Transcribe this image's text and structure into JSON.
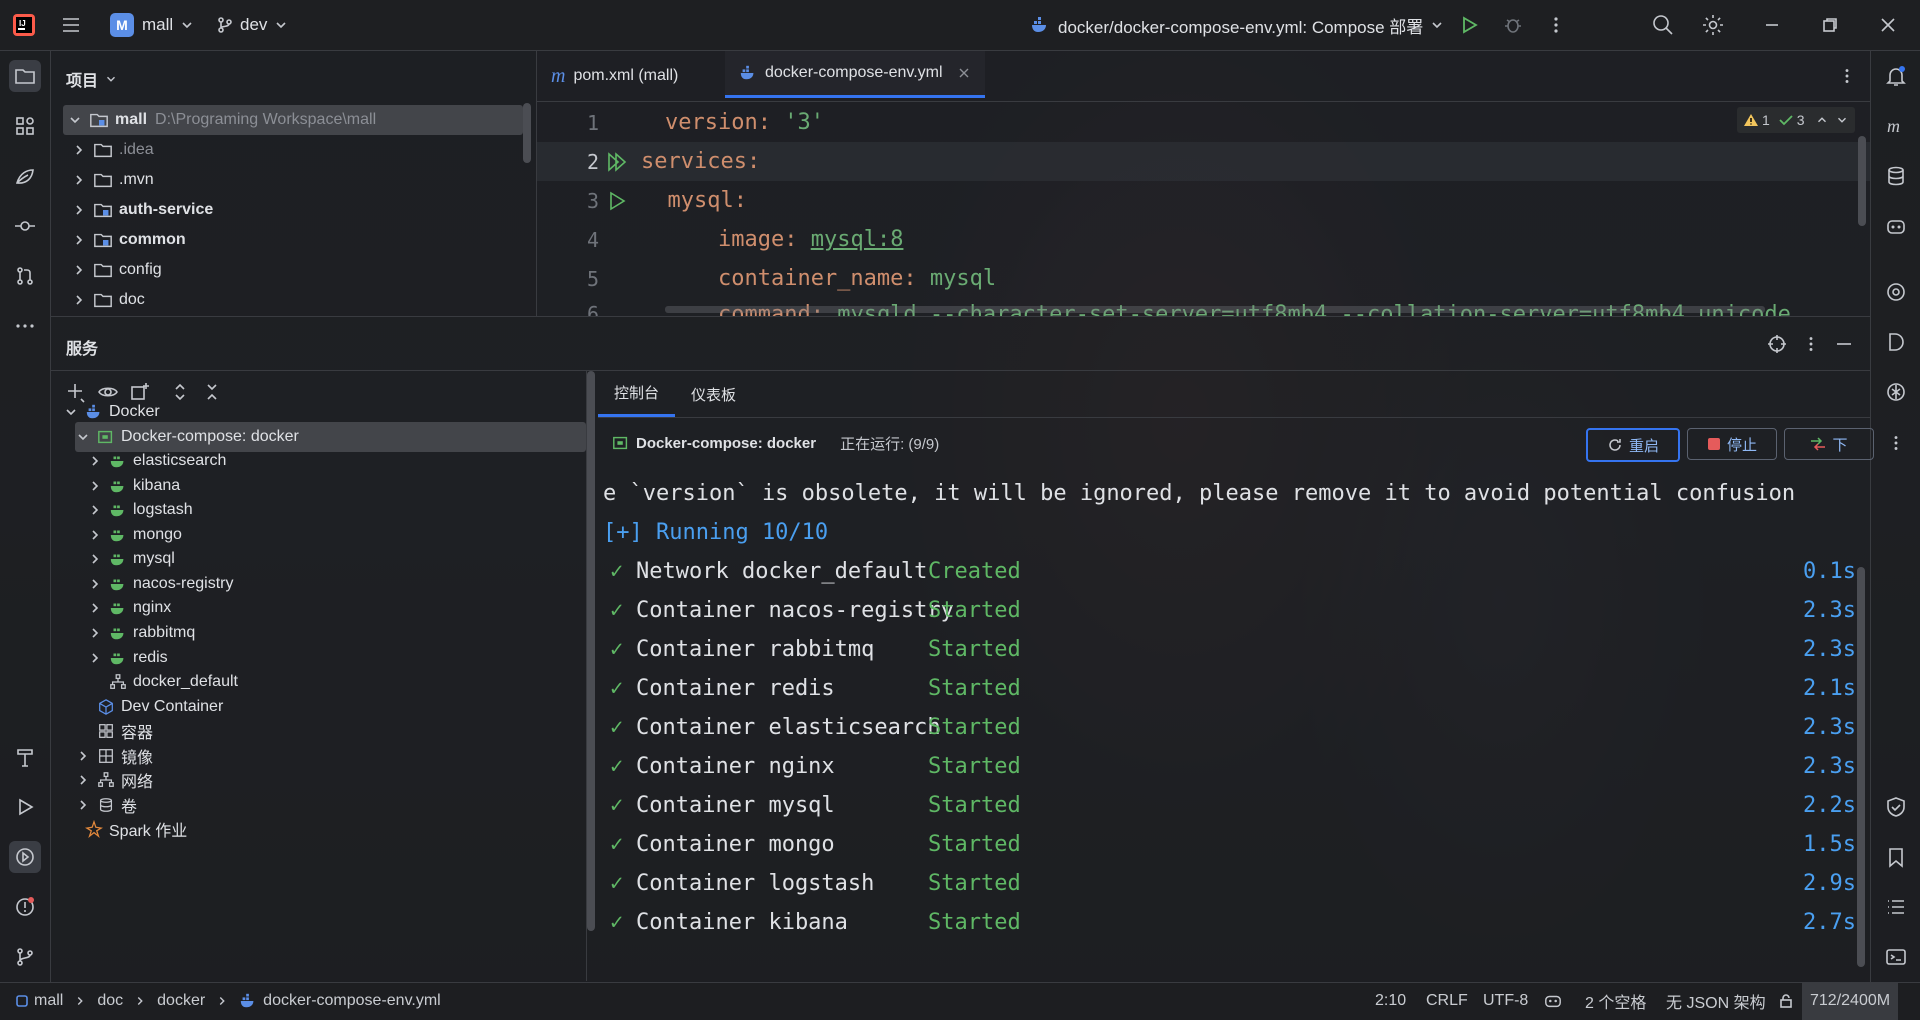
{
  "colors": {
    "accent": "#3574f0",
    "green": "#5fb865",
    "time_blue": "#4a9ff0",
    "keyword": "#cf8e6d",
    "string": "#6aab73"
  },
  "titlebar": {
    "project_badge": "M",
    "project": "mall",
    "branch": "dev",
    "run_config": "docker/docker-compose-env.yml: Compose 部署",
    "icons": [
      "app-logo-icon",
      "hamburger-menu-icon",
      "branch-icon",
      "docker-icon",
      "run-icon",
      "debug-icon",
      "more-vertical-icon",
      "search-icon",
      "gear-icon",
      "minimize-icon",
      "restore-icon",
      "close-icon"
    ]
  },
  "project_panel": {
    "title": "项目",
    "root": {
      "name": "mall",
      "path": "D:\\Programing Workspace\\mall"
    },
    "items": [
      {
        "label": ".idea",
        "bold": false
      },
      {
        "label": ".mvn",
        "bold": false
      },
      {
        "label": "auth-service",
        "bold": true
      },
      {
        "label": "common",
        "bold": true
      },
      {
        "label": "config",
        "bold": false
      },
      {
        "label": "doc",
        "bold": false
      }
    ]
  },
  "editor": {
    "tabs": [
      {
        "label": "pom.xml (mall)",
        "icon": "maven-icon"
      },
      {
        "label": "docker-compose-env.yml",
        "icon": "docker-icon",
        "active": true
      }
    ],
    "inspections": {
      "warnings": "1",
      "checks": "3"
    },
    "lines": [
      {
        "n": "1",
        "key": "version",
        "sep": ": ",
        "val": "'3'"
      },
      {
        "n": "2",
        "key": "services",
        "sep": ":",
        "val": ""
      },
      {
        "n": "3",
        "key": "  mysql",
        "sep": ":",
        "val": ""
      },
      {
        "n": "4",
        "key": "    image",
        "sep": ": ",
        "val": "mysql:8"
      },
      {
        "n": "5",
        "key": "    container_name",
        "sep": ": ",
        "val": "mysql"
      },
      {
        "n": "6",
        "key": "    command",
        "sep": ": ",
        "val": "mysqld --character-set-server=utf8mb4 --collation-server=utf8mb4_unicode"
      }
    ]
  },
  "services": {
    "title": "服务",
    "tree": [
      {
        "label": "Docker",
        "icon": "docker-icon"
      },
      {
        "label": "Docker-compose: docker",
        "icon": "compose-icon",
        "selected": true
      },
      {
        "label": "elasticsearch",
        "icon": "service-icon"
      },
      {
        "label": "kibana",
        "icon": "service-icon"
      },
      {
        "label": "logstash",
        "icon": "service-icon"
      },
      {
        "label": "mongo",
        "icon": "service-icon"
      },
      {
        "label": "mysql",
        "icon": "service-icon"
      },
      {
        "label": "nacos-registry",
        "icon": "service-icon"
      },
      {
        "label": "nginx",
        "icon": "service-icon"
      },
      {
        "label": "rabbitmq",
        "icon": "service-icon"
      },
      {
        "label": "redis",
        "icon": "service-icon"
      },
      {
        "label": "docker_default",
        "icon": "network-icon"
      },
      {
        "label": "Dev Container",
        "icon": "cube-icon"
      },
      {
        "label": "容器",
        "icon": "containers-icon"
      },
      {
        "label": "镜像",
        "icon": "images-icon"
      },
      {
        "label": "网络",
        "icon": "network-icon"
      },
      {
        "label": "卷",
        "icon": "volume-icon"
      },
      {
        "label": "Spark 作业",
        "icon": "spark-icon"
      }
    ],
    "tabs": [
      "控制台",
      "仪表板"
    ],
    "header": {
      "name": "Docker-compose: docker",
      "status": "正在运行: (9/9)"
    },
    "buttons": {
      "restart": "重启",
      "stop": "停止",
      "down": "下"
    },
    "log": {
      "warning": "e `version` is obsolete, it will be ignored, please remove it to avoid potential confusion",
      "running": "[+] Running 10/10",
      "rows": [
        {
          "name": "Network docker_default",
          "state": "Created",
          "time": "0.1s"
        },
        {
          "name": "Container nacos-registry",
          "state": "Started",
          "time": "2.3s"
        },
        {
          "name": "Container rabbitmq",
          "state": "Started",
          "time": "2.3s"
        },
        {
          "name": "Container redis",
          "state": "Started",
          "time": "2.1s"
        },
        {
          "name": "Container elasticsearch",
          "state": "Started",
          "time": "2.3s"
        },
        {
          "name": "Container nginx",
          "state": "Started",
          "time": "2.3s"
        },
        {
          "name": "Container mysql",
          "state": "Started",
          "time": "2.2s"
        },
        {
          "name": "Container mongo",
          "state": "Started",
          "time": "1.5s"
        },
        {
          "name": "Container logstash",
          "state": "Started",
          "time": "2.9s"
        },
        {
          "name": "Container kibana",
          "state": "Started",
          "time": "2.7s"
        }
      ]
    }
  },
  "statusbar": {
    "breadcrumbs": [
      "mall",
      "doc",
      "docker",
      "docker-compose-env.yml"
    ],
    "position": "2:10",
    "line_sep": "CRLF",
    "encoding": "UTF-8",
    "indent": "2 个空格",
    "schema": "无 JSON 架构",
    "memory": "712/2400M"
  }
}
